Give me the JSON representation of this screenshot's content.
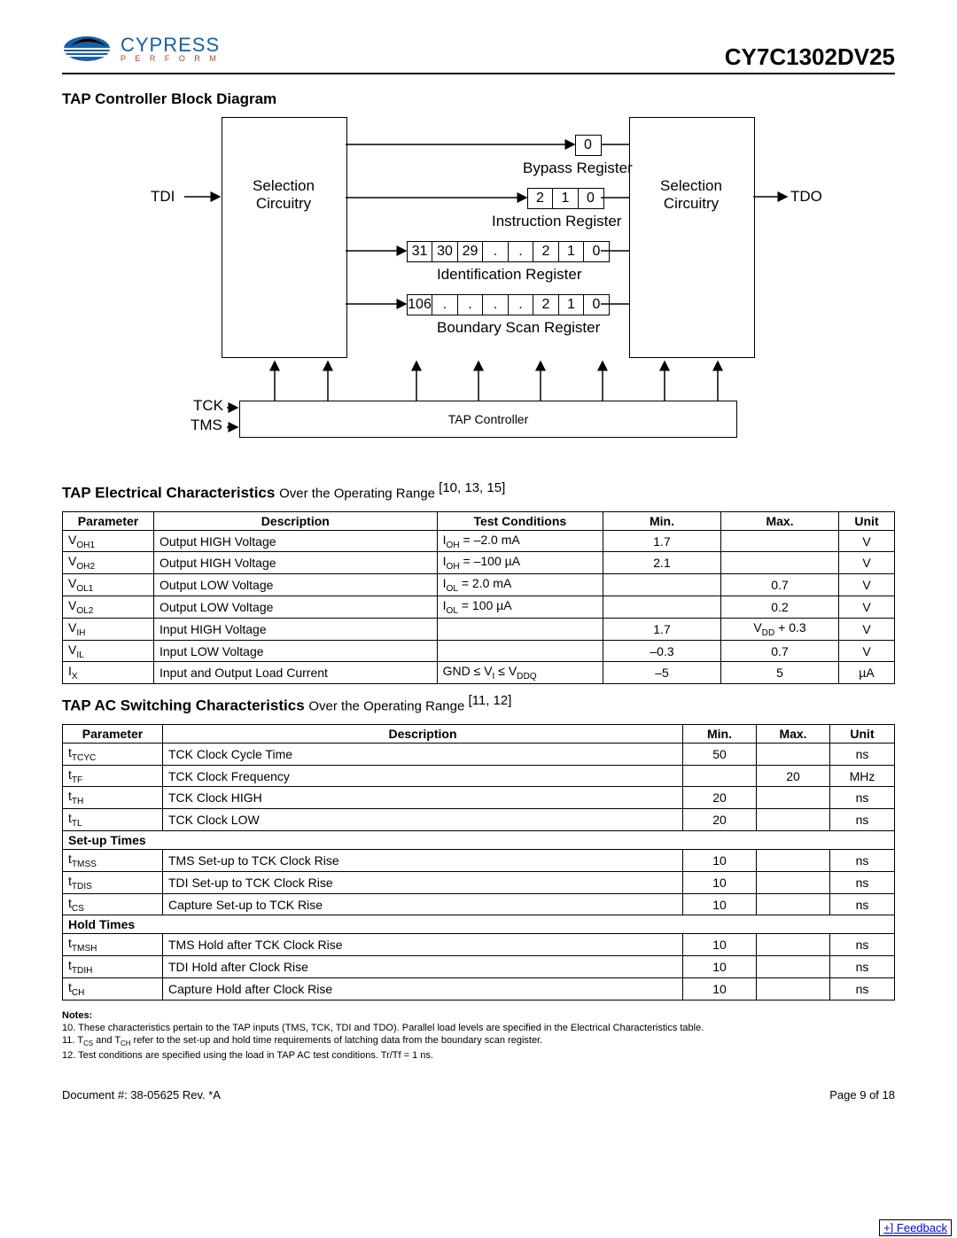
{
  "header": {
    "brand": "CYPRESS",
    "tagline": "P E R F O R M",
    "part": "CY7C1302DV25"
  },
  "diagram": {
    "title": "TAP Controller Block Diagram",
    "tdi": "TDI",
    "tdo": "TDO",
    "tck": "TCK",
    "tms": "TMS",
    "selLeft": "Selection Circuitry",
    "selRight": "Selection Circuitry",
    "bypass": "Bypass Register",
    "instr": "Instruction Register",
    "ident": "Identification Register",
    "bscan": "Boundary Scan Register",
    "tapctrl": "TAP Controller",
    "bypassCells": [
      "0"
    ],
    "instrCells": [
      "2",
      "1",
      "0"
    ],
    "identCells": [
      "31",
      "30",
      "29",
      ".",
      ".",
      "2",
      "1",
      "0"
    ],
    "bscanCells": [
      "106",
      ".",
      ".",
      ".",
      ".",
      "2",
      "1",
      "0"
    ]
  },
  "elec": {
    "title": "TAP Electrical Characteristics ",
    "titleNote": "Over the Operating Range ",
    "titleRefs": "[10, 13, 15]",
    "cols": [
      "Parameter",
      "Description",
      "Test Conditions",
      "Min.",
      "Max.",
      "Unit"
    ],
    "rows": [
      {
        "p": "V_OH1",
        "d": "Output HIGH Voltage",
        "tc": "I_OH = –2.0 mA",
        "min": "1.7",
        "max": "",
        "u": "V"
      },
      {
        "p": "V_OH2",
        "d": "Output HIGH Voltage",
        "tc": "I_OH = –100 µA",
        "min": "2.1",
        "max": "",
        "u": "V"
      },
      {
        "p": "V_OL1",
        "d": "Output LOW Voltage",
        "tc": "I_OL = 2.0 mA",
        "min": "",
        "max": "0.7",
        "u": "V"
      },
      {
        "p": "V_OL2",
        "d": "Output LOW Voltage",
        "tc": "I_OL = 100 µA",
        "min": "",
        "max": "0.2",
        "u": "V"
      },
      {
        "p": "V_IH",
        "d": "Input HIGH Voltage",
        "tc": "",
        "min": "1.7",
        "max": "V_DD + 0.3",
        "u": "V"
      },
      {
        "p": "V_IL",
        "d": "Input LOW Voltage",
        "tc": "",
        "min": "–0.3",
        "max": "0.7",
        "u": "V"
      },
      {
        "p": "I_X",
        "d": "Input and Output Load Current",
        "tc": "GND ≤ V_I ≤ V_DDQ",
        "min": "–5",
        "max": "5",
        "u": "µA"
      }
    ]
  },
  "ac": {
    "title": "TAP AC Switching Characteristics ",
    "titleNote": "Over the Operating Range ",
    "titleRefs": "[11, 12]",
    "cols": [
      "Parameter",
      "Description",
      "Min.",
      "Max.",
      "Unit"
    ],
    "rows": [
      {
        "type": "row",
        "p": "t_TCYC",
        "d": "TCK Clock Cycle Time",
        "min": "50",
        "max": "",
        "u": "ns"
      },
      {
        "type": "row",
        "p": "t_TF",
        "d": "TCK Clock Frequency",
        "min": "",
        "max": "20",
        "u": "MHz"
      },
      {
        "type": "row",
        "p": "t_TH",
        "d": "TCK Clock HIGH",
        "min": "20",
        "max": "",
        "u": "ns"
      },
      {
        "type": "row",
        "p": "t_TL",
        "d": "TCK Clock LOW",
        "min": "20",
        "max": "",
        "u": "ns"
      },
      {
        "type": "section",
        "label": "Set-up Times"
      },
      {
        "type": "row",
        "p": "t_TMSS",
        "d": "TMS Set-up to TCK Clock Rise",
        "min": "10",
        "max": "",
        "u": "ns"
      },
      {
        "type": "row",
        "p": "t_TDIS",
        "d": "TDI Set-up to TCK Clock Rise",
        "min": "10",
        "max": "",
        "u": "ns"
      },
      {
        "type": "row",
        "p": "t_CS",
        "d": "Capture Set-up to TCK Rise",
        "min": "10",
        "max": "",
        "u": "ns"
      },
      {
        "type": "section",
        "label": "Hold Times"
      },
      {
        "type": "row",
        "p": "t_TMSH",
        "d": "TMS Hold after TCK Clock Rise",
        "min": "10",
        "max": "",
        "u": "ns"
      },
      {
        "type": "row",
        "p": "t_TDIH",
        "d": "TDI Hold after Clock Rise",
        "min": "10",
        "max": "",
        "u": "ns"
      },
      {
        "type": "row",
        "p": "t_CH",
        "d": "Capture Hold after Clock Rise",
        "min": "10",
        "max": "",
        "u": "ns"
      }
    ]
  },
  "notes": {
    "heading": "Notes:",
    "items": [
      "10. These characteristics pertain to the TAP inputs (TMS, TCK, TDI and TDO). Parallel load levels are specified in the Electrical Characteristics table.",
      "11. T_CS and T_CH refer to the set-up and hold time requirements of latching data from the boundary scan register.",
      "12. Test conditions are specified using the load in TAP AC test conditions. Tr/Tf = 1 ns."
    ]
  },
  "footer": {
    "doc": "Document #: 38-05625 Rev. *A",
    "page": "Page 9 of 18",
    "feedback": "+] Feedback"
  }
}
